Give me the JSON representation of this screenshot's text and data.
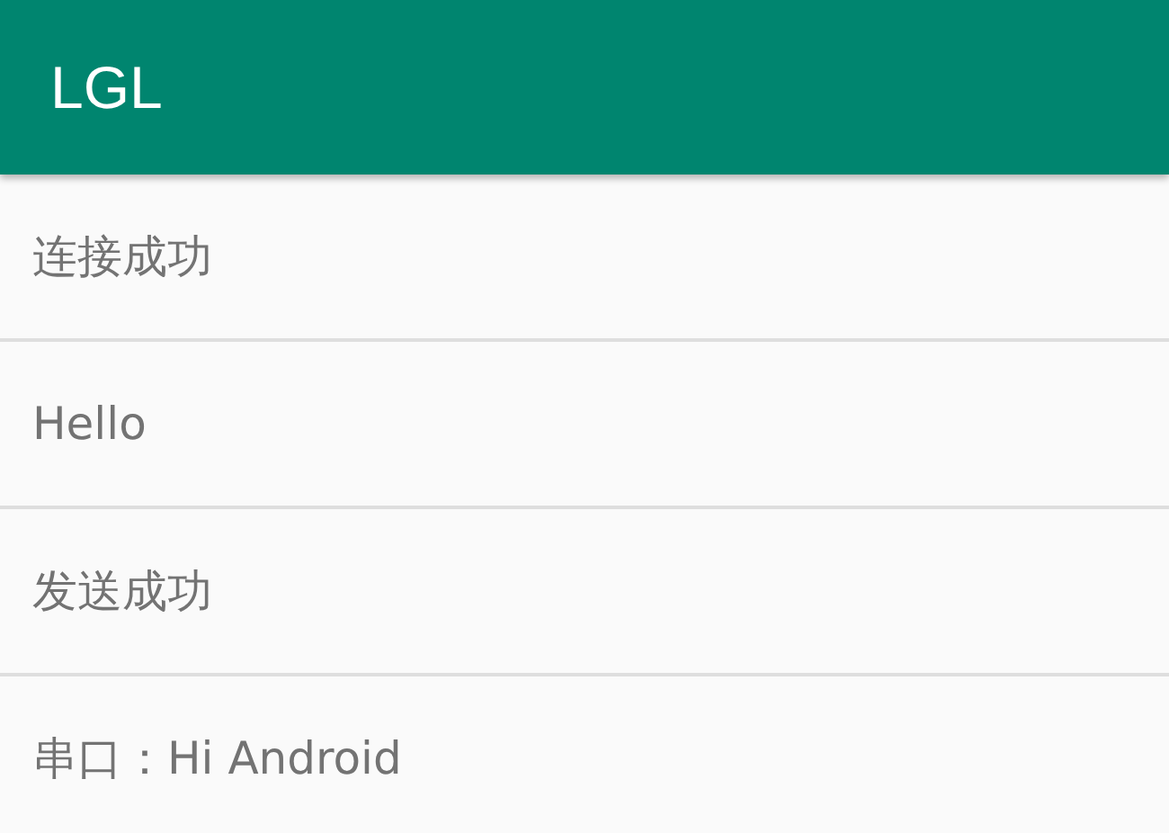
{
  "app_bar": {
    "title": "LGL"
  },
  "messages": [
    {
      "text": "连接成功"
    },
    {
      "text": "Hello"
    },
    {
      "text": "发送成功"
    },
    {
      "text": "串口：Hi Android"
    }
  ]
}
